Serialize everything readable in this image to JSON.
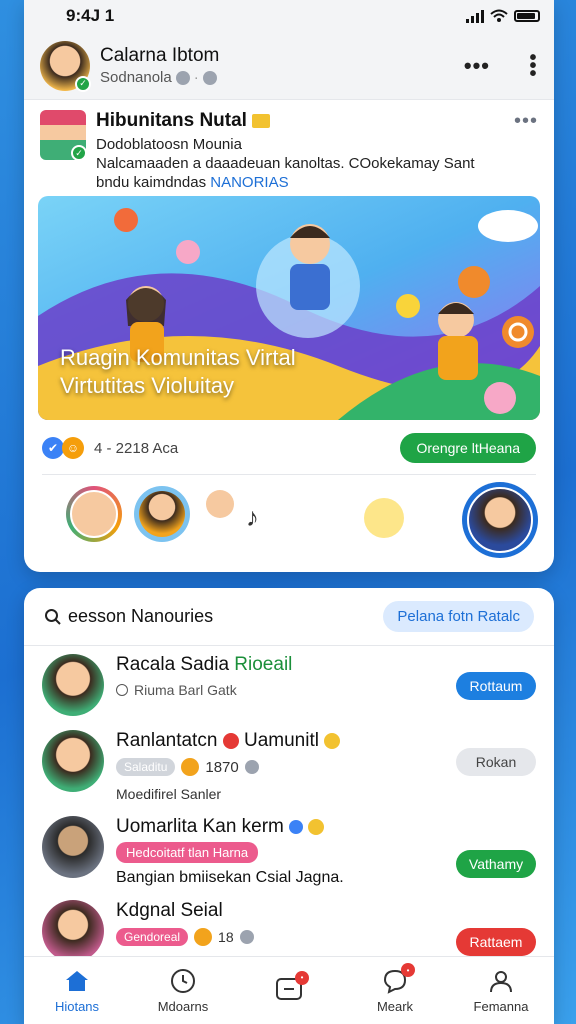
{
  "status_bar": {
    "time": "9:4J 1"
  },
  "profile": {
    "name": "Calarna Ibtom",
    "subtitle": "Sodnanola"
  },
  "post": {
    "title": "Hibunitans Nutal",
    "line1": "Dodoblatoosn Mounia",
    "line2": "Nalcamaaden a daaadeuan kanoltas. COokekamay Sant",
    "line3_prefix": "bndu kaimdndas ",
    "line3_tag": "NANORIAS",
    "banner_line1": "Ruagin Komunitas Virtal",
    "banner_line2": "Virtutitas Violuitay",
    "reaction_count": "4 - 2218 Aca",
    "join_label": "Orengre ltHeana"
  },
  "friends": {
    "title": "eesson Nanouries",
    "header_button": "Pelana fotn Ratalc",
    "items": [
      {
        "name": "Racala Sadia ",
        "name_accent": "Rioeail",
        "sub": "Riuma Barl Gatk",
        "button": "Rottaum",
        "button_color": "#1d7fe0"
      },
      {
        "name": "Ranlantatcn",
        "name_suffix": "Uamunitl",
        "pill": "Saladitu",
        "count": "1870",
        "extra": "Moedifirel Sanler",
        "button": "Rokan",
        "button_color": "#e5e7eb"
      },
      {
        "name": "Uomarlita Kan kerm",
        "pill": "Hedcoitatf tlan Harna",
        "extra": "Bangian bmiisekan Csial Jagna.",
        "button": "Vathamy",
        "button_color": "#1fa446"
      },
      {
        "name": "Kdgnal Seial",
        "pill": "Gendoreal",
        "count": "18",
        "button": "Rattaem",
        "button_color": "#e53935"
      }
    ]
  },
  "nav": {
    "items": [
      {
        "label": "Hiotans",
        "icon": "home-icon"
      },
      {
        "label": "Mdoarns",
        "icon": "clock-icon"
      },
      {
        "label": "",
        "icon": "video-icon"
      },
      {
        "label": "Meark",
        "icon": "chat-icon"
      },
      {
        "label": "Femanna",
        "icon": "profile-icon"
      }
    ]
  },
  "colors": {
    "accent": "#1d6fd6",
    "green": "#1fa446",
    "red": "#e53935"
  }
}
